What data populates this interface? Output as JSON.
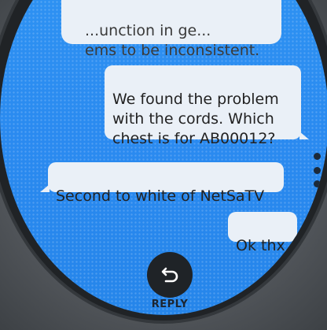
{
  "messages": {
    "top_partial": "...unction in ge...\nems to be inconsistent.",
    "sent_1": "We found the problem\nwith the cords. Which\nchest is for AB00012?",
    "received_1": "Second to white of NetSaTV",
    "sent_2": "Ok thx"
  },
  "actions": {
    "reply_label": "REPLY",
    "reply_icon": "reply-arrow-icon",
    "more_icon": "more-vert-icon"
  },
  "colors": {
    "screen_bg": "#2d8ff0",
    "bubble_bg": "#eaf0f7",
    "reply_button": "#1f2327"
  }
}
